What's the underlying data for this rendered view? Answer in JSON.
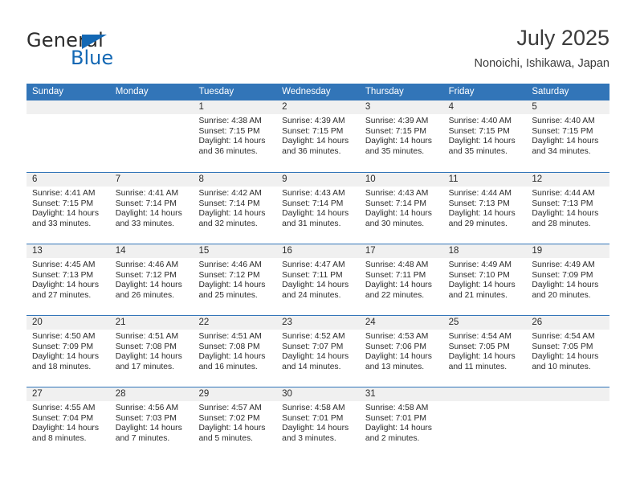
{
  "brand": {
    "name_part1": "General",
    "name_part2": "Blue",
    "triangle_color": "#1368b4"
  },
  "header": {
    "title": "July 2025",
    "subtitle": "Nonoichi, Ishikawa, Japan"
  },
  "theme": {
    "header_blue": "#3275b8",
    "day_band_gray": "#f0f0f0",
    "text_color": "#2b2b2b"
  },
  "weekday_headers": [
    "Sunday",
    "Monday",
    "Tuesday",
    "Wednesday",
    "Thursday",
    "Friday",
    "Saturday"
  ],
  "weeks": [
    [
      {
        "day": "",
        "empty": true
      },
      {
        "day": "",
        "empty": true
      },
      {
        "day": "1",
        "sunrise": "Sunrise: 4:38 AM",
        "sunset": "Sunset: 7:15 PM",
        "daylight": "Daylight: 14 hours and 36 minutes."
      },
      {
        "day": "2",
        "sunrise": "Sunrise: 4:39 AM",
        "sunset": "Sunset: 7:15 PM",
        "daylight": "Daylight: 14 hours and 36 minutes."
      },
      {
        "day": "3",
        "sunrise": "Sunrise: 4:39 AM",
        "sunset": "Sunset: 7:15 PM",
        "daylight": "Daylight: 14 hours and 35 minutes."
      },
      {
        "day": "4",
        "sunrise": "Sunrise: 4:40 AM",
        "sunset": "Sunset: 7:15 PM",
        "daylight": "Daylight: 14 hours and 35 minutes."
      },
      {
        "day": "5",
        "sunrise": "Sunrise: 4:40 AM",
        "sunset": "Sunset: 7:15 PM",
        "daylight": "Daylight: 14 hours and 34 minutes."
      }
    ],
    [
      {
        "day": "6",
        "sunrise": "Sunrise: 4:41 AM",
        "sunset": "Sunset: 7:15 PM",
        "daylight": "Daylight: 14 hours and 33 minutes."
      },
      {
        "day": "7",
        "sunrise": "Sunrise: 4:41 AM",
        "sunset": "Sunset: 7:14 PM",
        "daylight": "Daylight: 14 hours and 33 minutes."
      },
      {
        "day": "8",
        "sunrise": "Sunrise: 4:42 AM",
        "sunset": "Sunset: 7:14 PM",
        "daylight": "Daylight: 14 hours and 32 minutes."
      },
      {
        "day": "9",
        "sunrise": "Sunrise: 4:43 AM",
        "sunset": "Sunset: 7:14 PM",
        "daylight": "Daylight: 14 hours and 31 minutes."
      },
      {
        "day": "10",
        "sunrise": "Sunrise: 4:43 AM",
        "sunset": "Sunset: 7:14 PM",
        "daylight": "Daylight: 14 hours and 30 minutes."
      },
      {
        "day": "11",
        "sunrise": "Sunrise: 4:44 AM",
        "sunset": "Sunset: 7:13 PM",
        "daylight": "Daylight: 14 hours and 29 minutes."
      },
      {
        "day": "12",
        "sunrise": "Sunrise: 4:44 AM",
        "sunset": "Sunset: 7:13 PM",
        "daylight": "Daylight: 14 hours and 28 minutes."
      }
    ],
    [
      {
        "day": "13",
        "sunrise": "Sunrise: 4:45 AM",
        "sunset": "Sunset: 7:13 PM",
        "daylight": "Daylight: 14 hours and 27 minutes."
      },
      {
        "day": "14",
        "sunrise": "Sunrise: 4:46 AM",
        "sunset": "Sunset: 7:12 PM",
        "daylight": "Daylight: 14 hours and 26 minutes."
      },
      {
        "day": "15",
        "sunrise": "Sunrise: 4:46 AM",
        "sunset": "Sunset: 7:12 PM",
        "daylight": "Daylight: 14 hours and 25 minutes."
      },
      {
        "day": "16",
        "sunrise": "Sunrise: 4:47 AM",
        "sunset": "Sunset: 7:11 PM",
        "daylight": "Daylight: 14 hours and 24 minutes."
      },
      {
        "day": "17",
        "sunrise": "Sunrise: 4:48 AM",
        "sunset": "Sunset: 7:11 PM",
        "daylight": "Daylight: 14 hours and 22 minutes."
      },
      {
        "day": "18",
        "sunrise": "Sunrise: 4:49 AM",
        "sunset": "Sunset: 7:10 PM",
        "daylight": "Daylight: 14 hours and 21 minutes."
      },
      {
        "day": "19",
        "sunrise": "Sunrise: 4:49 AM",
        "sunset": "Sunset: 7:09 PM",
        "daylight": "Daylight: 14 hours and 20 minutes."
      }
    ],
    [
      {
        "day": "20",
        "sunrise": "Sunrise: 4:50 AM",
        "sunset": "Sunset: 7:09 PM",
        "daylight": "Daylight: 14 hours and 18 minutes."
      },
      {
        "day": "21",
        "sunrise": "Sunrise: 4:51 AM",
        "sunset": "Sunset: 7:08 PM",
        "daylight": "Daylight: 14 hours and 17 minutes."
      },
      {
        "day": "22",
        "sunrise": "Sunrise: 4:51 AM",
        "sunset": "Sunset: 7:08 PM",
        "daylight": "Daylight: 14 hours and 16 minutes."
      },
      {
        "day": "23",
        "sunrise": "Sunrise: 4:52 AM",
        "sunset": "Sunset: 7:07 PM",
        "daylight": "Daylight: 14 hours and 14 minutes."
      },
      {
        "day": "24",
        "sunrise": "Sunrise: 4:53 AM",
        "sunset": "Sunset: 7:06 PM",
        "daylight": "Daylight: 14 hours and 13 minutes."
      },
      {
        "day": "25",
        "sunrise": "Sunrise: 4:54 AM",
        "sunset": "Sunset: 7:05 PM",
        "daylight": "Daylight: 14 hours and 11 minutes."
      },
      {
        "day": "26",
        "sunrise": "Sunrise: 4:54 AM",
        "sunset": "Sunset: 7:05 PM",
        "daylight": "Daylight: 14 hours and 10 minutes."
      }
    ],
    [
      {
        "day": "27",
        "sunrise": "Sunrise: 4:55 AM",
        "sunset": "Sunset: 7:04 PM",
        "daylight": "Daylight: 14 hours and 8 minutes."
      },
      {
        "day": "28",
        "sunrise": "Sunrise: 4:56 AM",
        "sunset": "Sunset: 7:03 PM",
        "daylight": "Daylight: 14 hours and 7 minutes."
      },
      {
        "day": "29",
        "sunrise": "Sunrise: 4:57 AM",
        "sunset": "Sunset: 7:02 PM",
        "daylight": "Daylight: 14 hours and 5 minutes."
      },
      {
        "day": "30",
        "sunrise": "Sunrise: 4:58 AM",
        "sunset": "Sunset: 7:01 PM",
        "daylight": "Daylight: 14 hours and 3 minutes."
      },
      {
        "day": "31",
        "sunrise": "Sunrise: 4:58 AM",
        "sunset": "Sunset: 7:01 PM",
        "daylight": "Daylight: 14 hours and 2 minutes."
      },
      {
        "day": "",
        "empty": true
      },
      {
        "day": "",
        "empty": true
      }
    ]
  ]
}
